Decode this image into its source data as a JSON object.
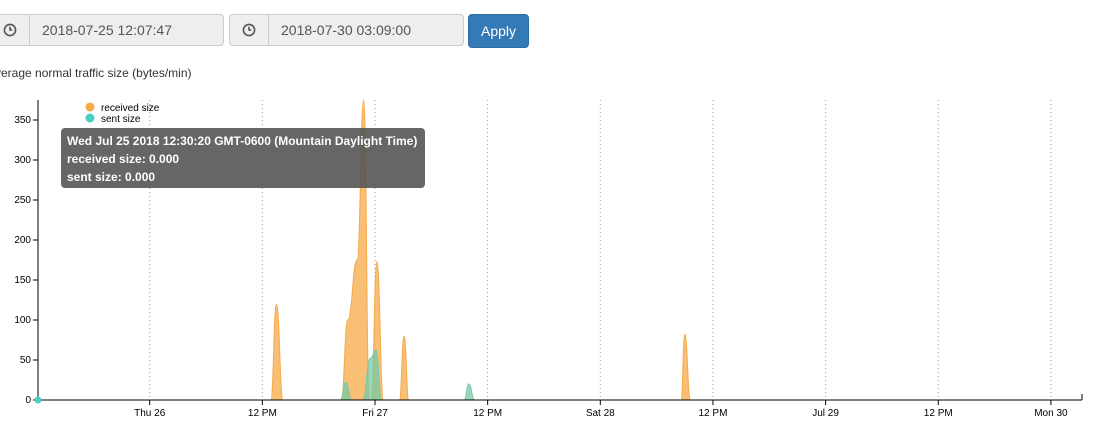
{
  "controls": {
    "start_datetime": "2018-07-25 12:07:47",
    "end_datetime": "2018-07-30 03:09:00",
    "apply_label": "Apply",
    "icon": "clock-icon"
  },
  "chart_title": "verage normal traffic size (bytes/min)",
  "tooltip": {
    "line1": "Wed Jul 25 2018 12:30:20 GMT-0600 (Mountain Daylight Time)",
    "line2": "received size: 0.000",
    "line3": "sent size: 0.000"
  },
  "colors": {
    "received": "#f6a947",
    "sent": "#76c9a6",
    "sent_legend": "#4ecdc4",
    "axis": "#000",
    "grid": "#999"
  },
  "chart_data": {
    "type": "area",
    "title": "verage normal traffic size (bytes/min)",
    "x_unit": "hours since 2018-07-25 12:07:47",
    "xlim": [
      0,
      111.0
    ],
    "ylim": [
      0,
      375
    ],
    "grid": "vertical dotted at day/noon boundaries",
    "legend": "top-left",
    "x_ticks": [
      {
        "hour": 11.9,
        "label": "Thu 26"
      },
      {
        "hour": 23.9,
        "label": "12 PM"
      },
      {
        "hour": 35.9,
        "label": "Fri 27"
      },
      {
        "hour": 47.9,
        "label": "12 PM"
      },
      {
        "hour": 59.9,
        "label": "Sat 28"
      },
      {
        "hour": 71.9,
        "label": "12 PM"
      },
      {
        "hour": 83.9,
        "label": "Jul 29"
      },
      {
        "hour": 95.9,
        "label": "12 PM"
      },
      {
        "hour": 107.9,
        "label": "Mon 30"
      }
    ],
    "y_ticks": [
      0,
      50,
      100,
      150,
      200,
      250,
      300,
      350
    ],
    "series": [
      {
        "name": "received size",
        "points": [
          [
            0,
            0
          ],
          [
            24.8,
            0
          ],
          [
            25.4,
            120
          ],
          [
            26.1,
            0
          ],
          [
            32.3,
            0
          ],
          [
            33.0,
            100
          ],
          [
            34.0,
            175
          ],
          [
            34.7,
            375
          ],
          [
            35.3,
            0
          ],
          [
            35.5,
            0
          ],
          [
            36.1,
            173
          ],
          [
            36.8,
            0
          ],
          [
            38.5,
            0
          ],
          [
            39.0,
            80
          ],
          [
            39.5,
            0
          ],
          [
            68.5,
            0
          ],
          [
            68.9,
            82
          ],
          [
            69.5,
            0
          ],
          [
            111.0,
            0
          ]
        ]
      },
      {
        "name": "sent size",
        "points": [
          [
            0,
            0
          ],
          [
            32.2,
            0
          ],
          [
            32.8,
            22
          ],
          [
            33.4,
            0
          ],
          [
            34.6,
            0
          ],
          [
            35.4,
            52
          ],
          [
            36.0,
            62
          ],
          [
            36.6,
            0
          ],
          [
            45.4,
            0
          ],
          [
            45.9,
            20
          ],
          [
            46.5,
            0
          ],
          [
            111.0,
            0
          ]
        ]
      }
    ]
  }
}
